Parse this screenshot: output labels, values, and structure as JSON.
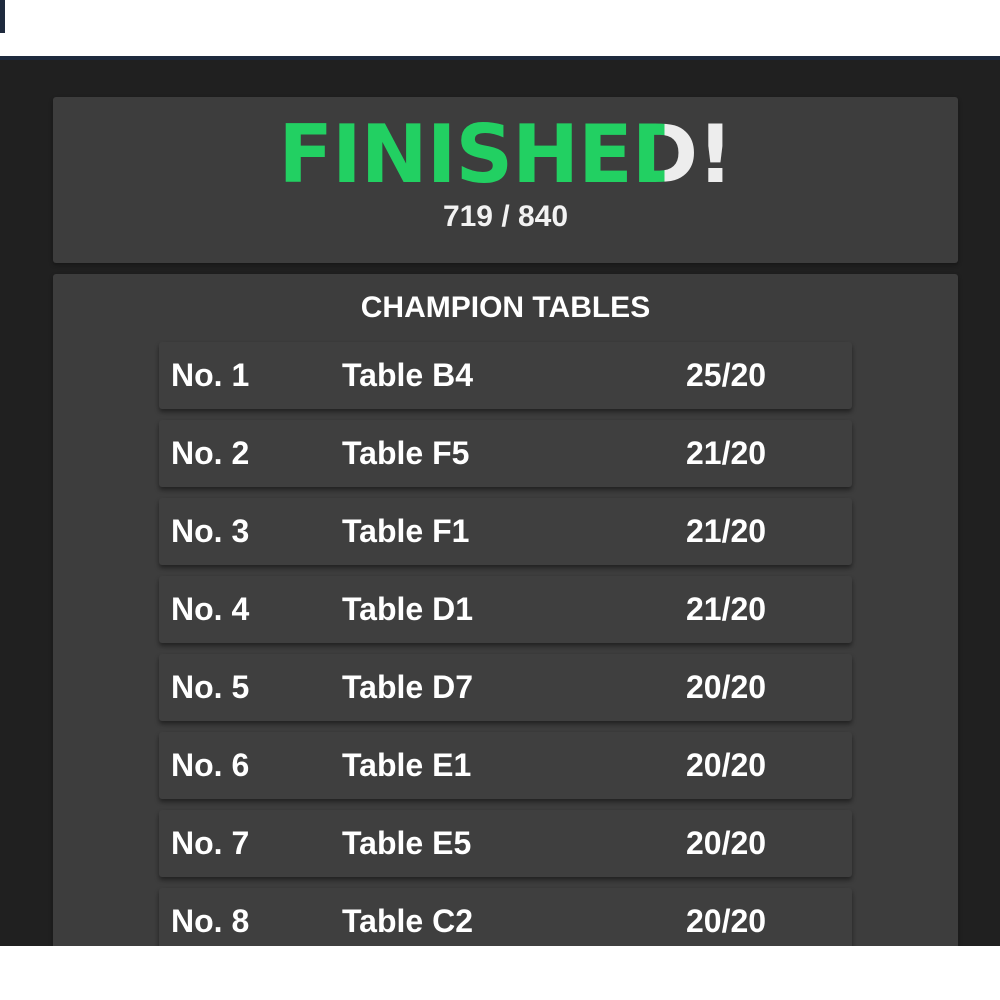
{
  "header": {
    "title_green": "FINISHE",
    "title_split_letter": "D",
    "title_end": "!",
    "score": "719 / 840"
  },
  "champions": {
    "title": "CHAMPION TABLES",
    "rows": [
      {
        "rank": "No. 1",
        "table": "Table B4",
        "score": "25/20"
      },
      {
        "rank": "No. 2",
        "table": "Table F5",
        "score": "21/20"
      },
      {
        "rank": "No. 3",
        "table": "Table F1",
        "score": "21/20"
      },
      {
        "rank": "No. 4",
        "table": "Table D1",
        "score": "21/20"
      },
      {
        "rank": "No. 5",
        "table": "Table D7",
        "score": "20/20"
      },
      {
        "rank": "No. 6",
        "table": "Table E1",
        "score": "20/20"
      },
      {
        "rank": "No. 7",
        "table": "Table E5",
        "score": "20/20"
      },
      {
        "rank": "No. 8",
        "table": "Table C2",
        "score": "20/20"
      }
    ]
  },
  "colors": {
    "accent_green": "#22d062",
    "panel_background": "#3d3d3d",
    "page_background": "#202020"
  }
}
